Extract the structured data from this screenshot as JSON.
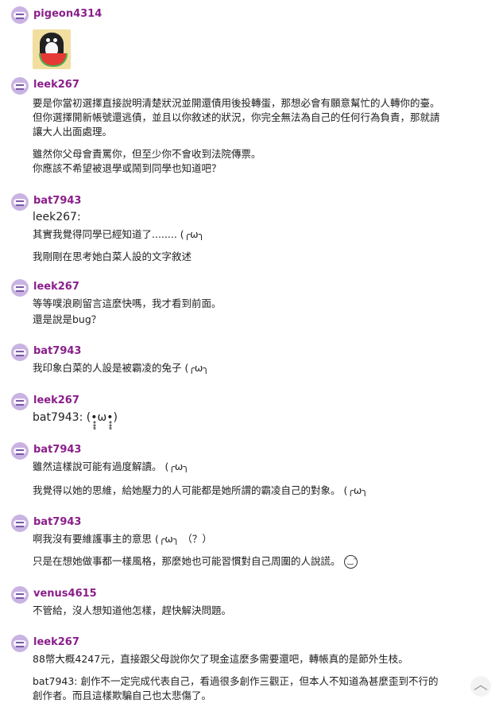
{
  "comments": [
    {
      "user": "pigeon4314",
      "has_sticker": true
    },
    {
      "user": "leek267",
      "lines": [
        "要是你當初選擇直接說明清楚狀況並開還債用後投轉蛋，那想必會有願意幫忙的人轉你的臺。",
        "但你選擇開新帳號還逃債，並且以你敘述的狀況，你完全無法為自己的任何行為負責，那就請",
        "讓大人出面處理。",
        "雖然你父母會責罵你，但至少你不會收到法院傳票。",
        "你應該不希望被退學或鬧到同學也知道吧？"
      ]
    },
    {
      "user": "bat7943",
      "lines": [
        "leek267:",
        "其實我覺得同學已經知道了........ (╭ω╮",
        "我剛剛在思考她白菜人設的文字敘述"
      ]
    },
    {
      "user": "leek267",
      "lines": [
        "等等噗浪刷留言這麼快嗎，我才看到前面。",
        "還是說是bug？"
      ]
    },
    {
      "user": "bat7943",
      "lines": [
        "我印象白菜的人設是被霸凌的兔子 (╭ω╮"
      ]
    },
    {
      "user": "leek267",
      "lines": [
        "bat7943: (•̥̥̥ω•̥̥̥)"
      ]
    },
    {
      "user": "bat7943",
      "lines": [
        "雖然這樣說可能有過度解讀。 (╭ω╮",
        "我覺得以她的思維，給她壓力的人可能都是她所謂的霸凌自己的對象。 (╭ω╮"
      ]
    },
    {
      "user": "bat7943",
      "lines": [
        "啊我沒有要維護事主的意思 (╭ω╮ （？）",
        "只是在想她做事都一樣風格，那麼她也可能習慣對自己周圍的人說謊。"
      ]
    },
    {
      "user": "venus4615",
      "lines": [
        "不管給，沒人想知道他怎樣，趕快解決問題。"
      ]
    },
    {
      "user": "leek267",
      "lines": [
        "88幣大概4247元，直接跟父母說你欠了現金這麼多需要還吧，轉帳真的是節外生枝。",
        "bat7943: 創作不一定完成代表自己，看過很多創作三觀正，但本人不知道為甚麼歪到不行的",
        "創作者。而且這樣欺騙自己也太悲傷了。"
      ]
    }
  ],
  "icons": {
    "avatar": "avatar-icon",
    "sticker": "penguin-watermelon-sticker",
    "scroll_top": "chevron-up-icon",
    "face": "smile-emoji-icon"
  },
  "colors": {
    "username": "#8a1f8a",
    "avatar_bg": "#c9b3e3"
  },
  "scroll_top_glyph": "︿"
}
